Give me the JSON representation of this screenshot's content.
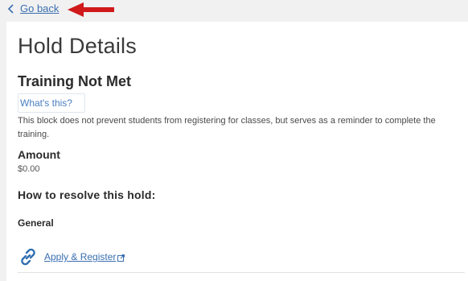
{
  "nav": {
    "back_label": "Go back"
  },
  "hold": {
    "page_title": "Hold Details",
    "name": "Training Not Met",
    "whats_this_label": "What's this?",
    "description": "This block does not prevent students from registering for classes, but serves as a reminder to complete the training.",
    "amount_label": "Amount",
    "amount_value": "$0.00"
  },
  "resolve": {
    "heading": "How to resolve this hold:",
    "section_label": "General",
    "link_label": "Apply & Register"
  },
  "icons": {
    "back": "chevron-left-icon",
    "annotation": "red-arrow-annotation",
    "link": "link-chain-icon",
    "external": "external-link-icon"
  },
  "colors": {
    "link": "#3a6fb0",
    "annotation_arrow": "#d0191b",
    "background": "#f1f1f1",
    "card": "#ffffff"
  }
}
